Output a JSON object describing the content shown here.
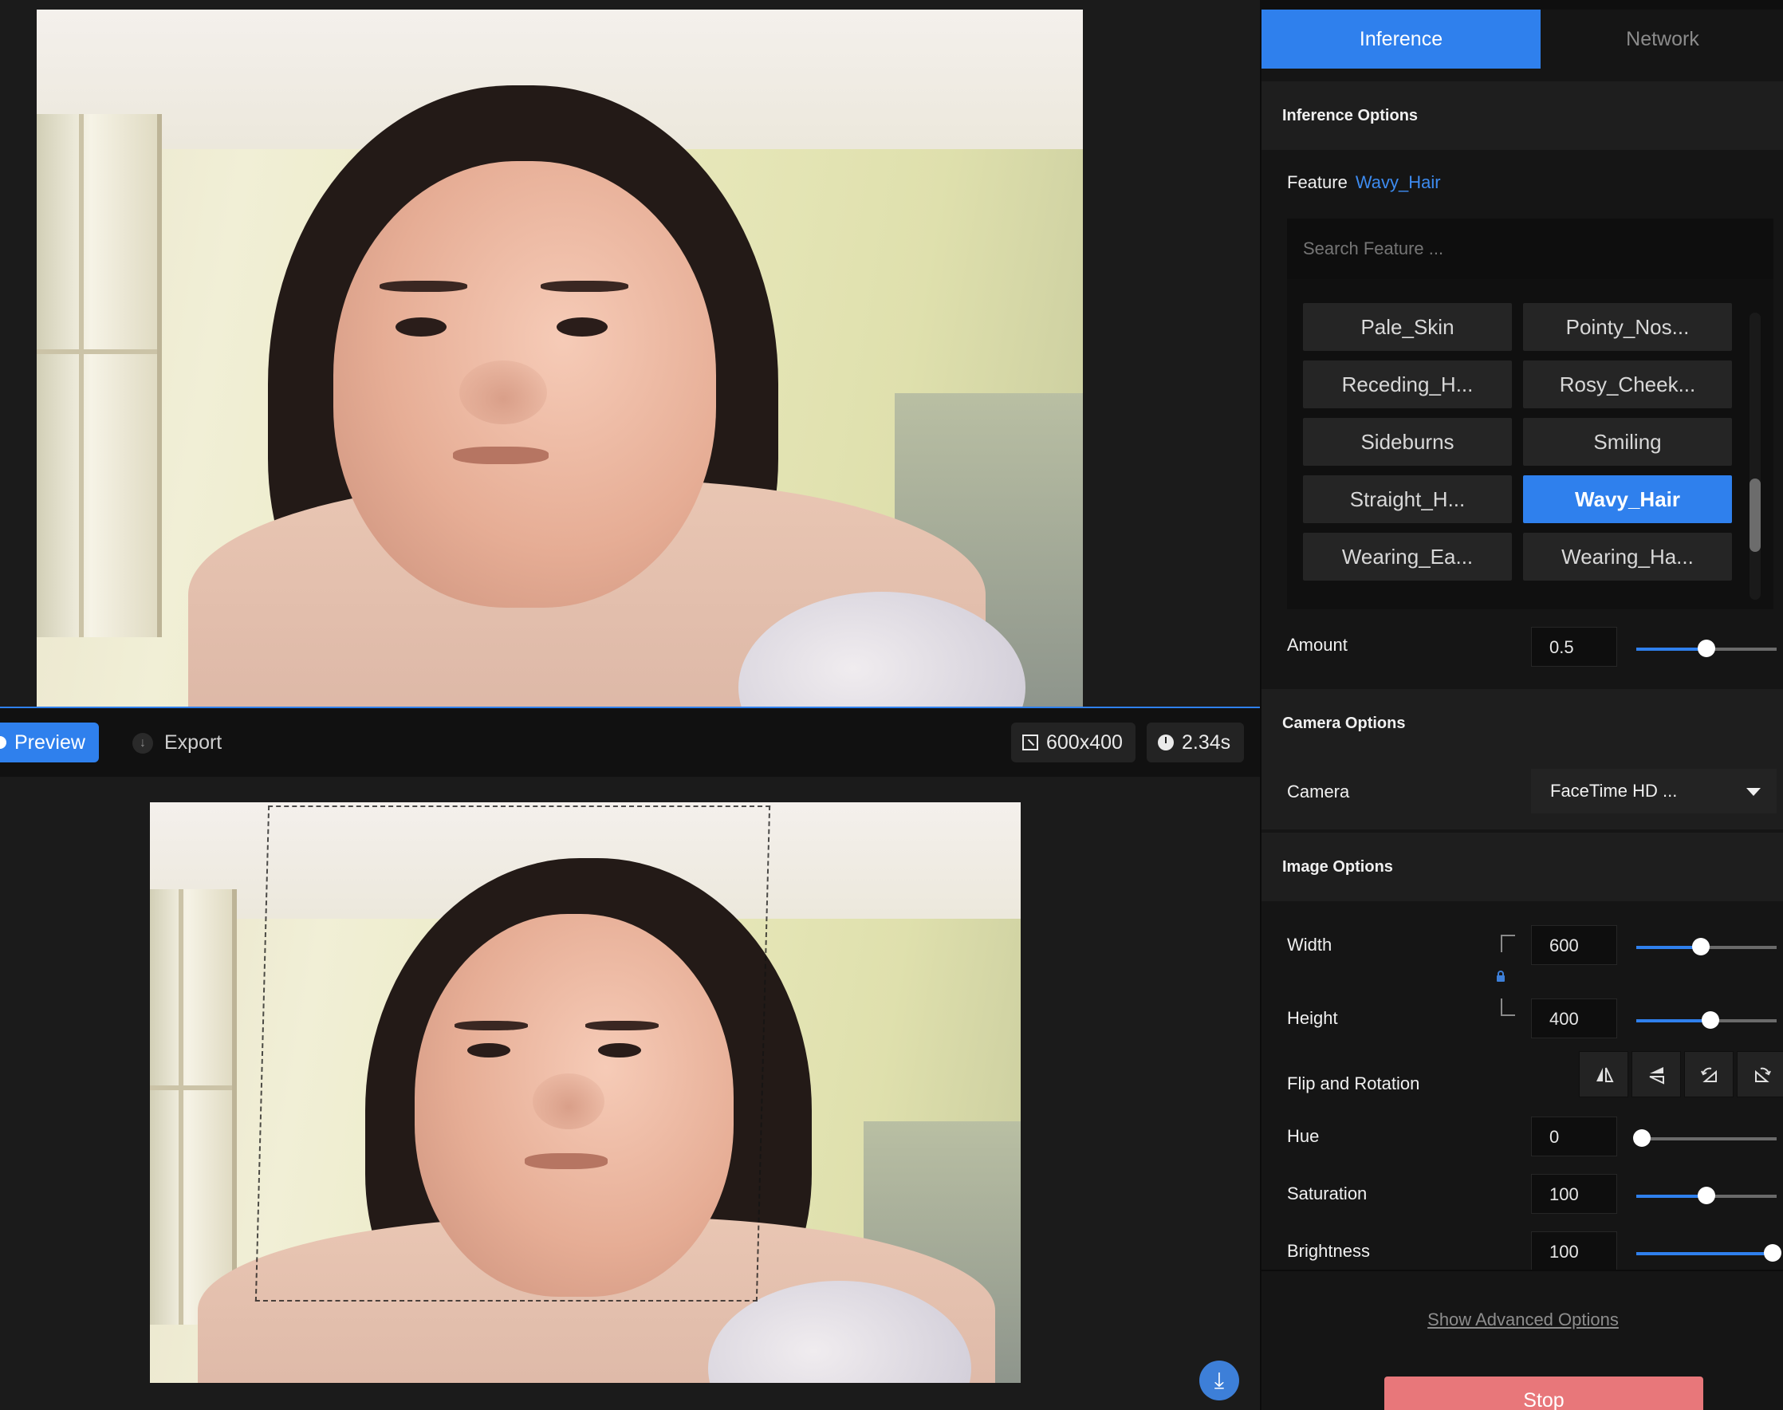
{
  "toolbar": {
    "preview_label": "Preview",
    "export_label": "Export",
    "resolution": "600x400",
    "time": "2.34s",
    "preview_icon": "dot-icon",
    "export_icon": "download-circle-icon",
    "resolution_icon": "resize-icon",
    "time_icon": "clock-icon"
  },
  "tabs": {
    "inference": "Inference",
    "network": "Network",
    "active": "Inference"
  },
  "inference_options": {
    "title": "Inference Options",
    "feature_label": "Feature",
    "feature_value": "Wavy_Hair",
    "search_placeholder": "Search Feature ...",
    "features": [
      "Pale_Skin",
      "Pointy_Nos...",
      "Receding_H...",
      "Rosy_Cheek...",
      "Sideburns",
      "Smiling",
      "Straight_H...",
      "Wavy_Hair",
      "Wearing_Ea...",
      "Wearing_Ha..."
    ],
    "selected_feature": "Wavy_Hair",
    "amount_label": "Amount",
    "amount_value": "0.5",
    "amount_fraction": 0.5
  },
  "camera_options": {
    "title": "Camera Options",
    "camera_label": "Camera",
    "camera_value": "FaceTime HD ..."
  },
  "image_options": {
    "title": "Image Options",
    "width_label": "Width",
    "width_value": "600",
    "width_fraction": 0.46,
    "height_label": "Height",
    "height_value": "400",
    "height_fraction": 0.53,
    "flip_label": "Flip and Rotation",
    "flip_icons": [
      "flip-horizontal-icon",
      "flip-vertical-icon",
      "rotate-left-icon",
      "rotate-right-icon"
    ],
    "hue_label": "Hue",
    "hue_value": "0",
    "hue_fraction": 0.04,
    "saturation_label": "Saturation",
    "saturation_value": "100",
    "saturation_fraction": 0.5,
    "brightness_label": "Brightness",
    "brightness_value": "100",
    "brightness_fraction": 0.97,
    "lock_icon": "lock-icon"
  },
  "footer": {
    "advanced_link": "Show Advanced Options",
    "stop_label": "Stop",
    "download_icon": "download-icon"
  },
  "colors": {
    "accent": "#2f80ed",
    "stop": "#e8777a",
    "panel": "#151515",
    "section": "#1e1e1e"
  }
}
